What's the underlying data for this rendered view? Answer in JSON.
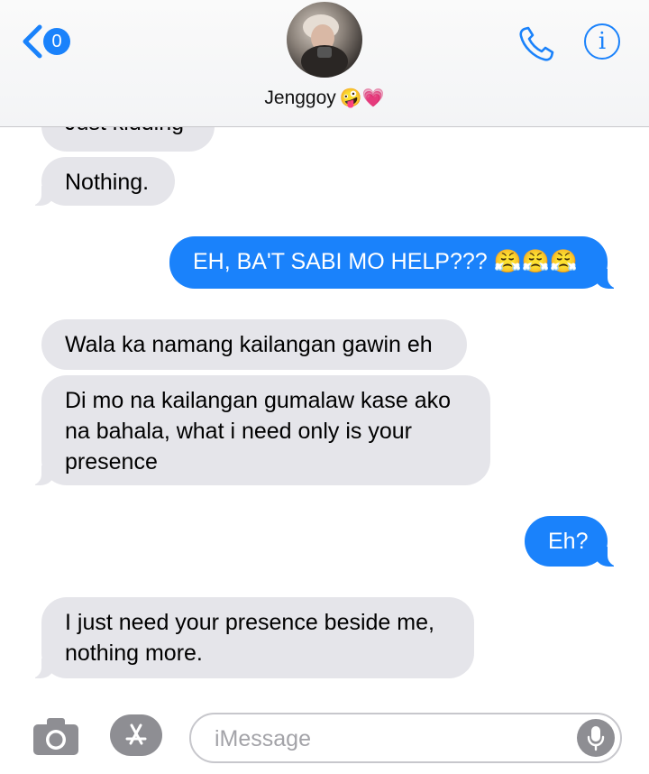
{
  "header": {
    "back_badge_count": "0",
    "contact_name": "Jenggoy",
    "contact_emoji": "🤪💗"
  },
  "messages": [
    {
      "direction": "incoming",
      "text": "Just kidding"
    },
    {
      "direction": "incoming",
      "text": "Nothing."
    },
    {
      "direction": "outgoing",
      "text": "EH, BA'T SABI MO HELP??? 😤😤😤"
    },
    {
      "direction": "incoming",
      "text": "Wala ka namang kailangan gawin eh"
    },
    {
      "direction": "incoming",
      "text": "Di mo na kailangan gumalaw kase ako na bahala, what i need only is your presence"
    },
    {
      "direction": "outgoing",
      "text": "Eh?"
    },
    {
      "direction": "incoming",
      "text": "I just need your presence beside me, nothing more."
    }
  ],
  "input": {
    "placeholder": "iMessage",
    "value": ""
  },
  "colors": {
    "accent": "#1a82fb",
    "incoming_bubble": "#e5e5ea",
    "outgoing_bubble": "#1a82fb"
  },
  "icons": [
    "chevron-left-icon",
    "phone-icon",
    "info-icon",
    "camera-icon",
    "app-store-icon",
    "microphone-icon"
  ]
}
